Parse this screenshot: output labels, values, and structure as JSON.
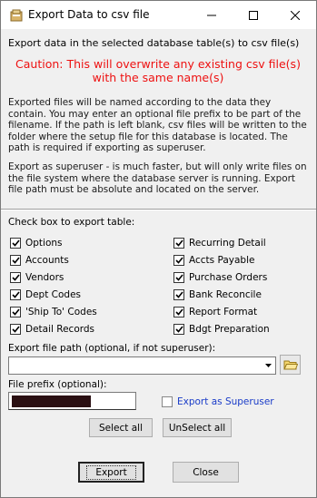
{
  "window": {
    "title": "Export Data to csv file"
  },
  "intro": "Export data in the selected database table(s) to csv file(s)",
  "caution": {
    "line1": "Caution: This will overwrite any existing csv file(s)",
    "line2": "with the same name(s)"
  },
  "info": {
    "paragraph1": "Exported files will be named according to the data they contain. You may enter an optional file prefix to be part of the filename. If the path is left blank, csv files will be written to the folder where the setup file for this database is located. The path is required if exporting as superuser.",
    "paragraph2": "Export as superuser - is much faster, but will only write files on the file system where the database server is running. Export file path must be absolute and located on the server."
  },
  "tables": {
    "heading": "Check box to export table:",
    "left": [
      {
        "label": "Options",
        "checked": true
      },
      {
        "label": "Accounts",
        "checked": true
      },
      {
        "label": "Vendors",
        "checked": true
      },
      {
        "label": "Dept Codes",
        "checked": true
      },
      {
        "label": "'Ship To' Codes",
        "checked": true
      },
      {
        "label": "Detail Records",
        "checked": true
      }
    ],
    "right": [
      {
        "label": "Recurring Detail",
        "checked": true
      },
      {
        "label": "Accts Payable",
        "checked": true
      },
      {
        "label": "Purchase Orders",
        "checked": true
      },
      {
        "label": "Bank Reconcile",
        "checked": true
      },
      {
        "label": "Report Format",
        "checked": true
      },
      {
        "label": "Bdgt Preparation",
        "checked": true
      }
    ]
  },
  "path": {
    "label": "Export file path (optional, if not superuser):",
    "value": ""
  },
  "prefix": {
    "label": "File prefix (optional):"
  },
  "superuser": {
    "label": "Export as Superuser",
    "checked": false
  },
  "buttons": {
    "select_all": "Select all",
    "unselect_all": "UnSelect all",
    "export": "Export",
    "close": "Close"
  },
  "colors": {
    "caution": "#ee1111",
    "superuser_link": "#1a3cc8"
  }
}
